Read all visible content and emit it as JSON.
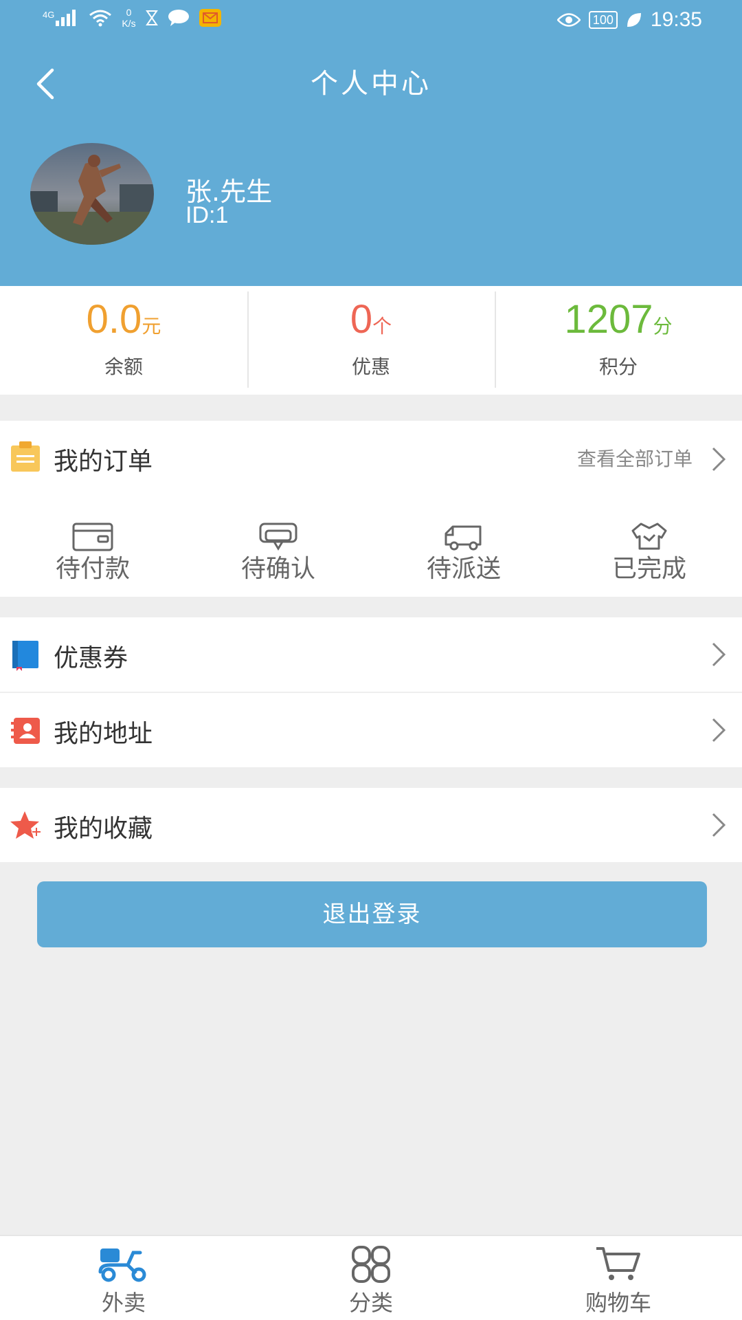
{
  "status_bar": {
    "network": "4G",
    "speed_value": "0",
    "speed_unit": "K/s",
    "battery": "100",
    "time": "19:35"
  },
  "header": {
    "title": "个人中心",
    "user_name": "张.先生",
    "user_id": "ID:1"
  },
  "stats": [
    {
      "value": "0.0",
      "unit": "元",
      "label": "余额",
      "color": "#f0a030"
    },
    {
      "value": "0",
      "unit": "个",
      "label": "优惠",
      "color": "#ee6655"
    },
    {
      "value": "1207",
      "unit": "分",
      "label": "积分",
      "color": "#6cba3c"
    }
  ],
  "orders": {
    "title": "我的订单",
    "view_all": "查看全部订单",
    "tabs": [
      {
        "label": "待付款",
        "icon": "wallet-icon"
      },
      {
        "label": "待确认",
        "icon": "confirm-chat-icon"
      },
      {
        "label": "待派送",
        "icon": "truck-icon"
      },
      {
        "label": "已完成",
        "icon": "completed-shirt-icon"
      }
    ]
  },
  "menu": {
    "coupons": "优惠券",
    "address": "我的地址",
    "favorites": "我的收藏"
  },
  "logout_label": "退出登录",
  "tabbar": [
    {
      "label": "外卖",
      "icon": "scooter-icon",
      "active": true
    },
    {
      "label": "分类",
      "icon": "category-icon",
      "active": false
    },
    {
      "label": "购物车",
      "icon": "cart-icon",
      "active": false
    }
  ],
  "colors": {
    "primary": "#62acd6",
    "balance": "#f0a030",
    "coupon": "#ee6655",
    "points": "#6cba3c"
  }
}
